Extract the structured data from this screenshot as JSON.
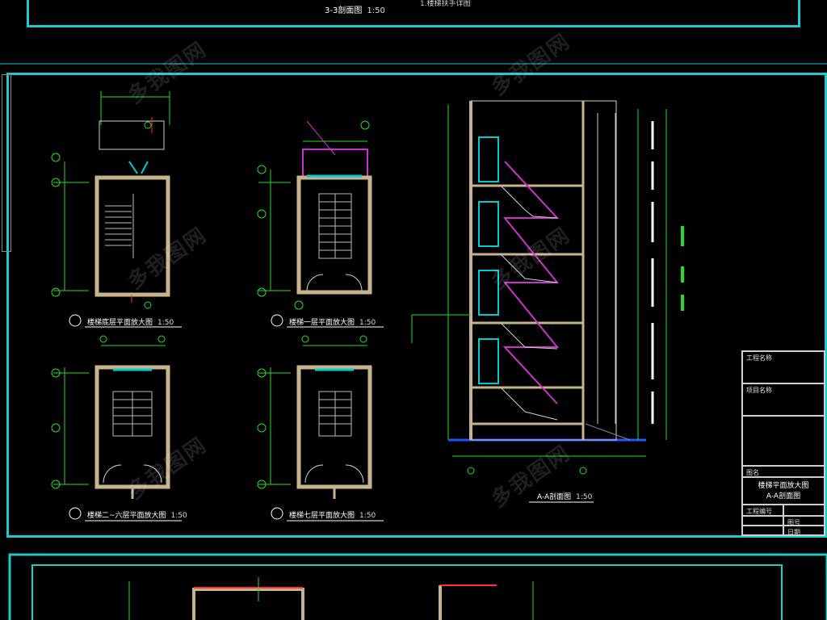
{
  "top_sheet": {
    "section_title": "3-3剖面图",
    "section_scale": "1:50",
    "note": "1.楼梯扶手详图"
  },
  "main_sheet": {
    "plans": [
      {
        "title": "楼梯底层平面放大图",
        "scale": "1:50"
      },
      {
        "title": "楼梯一层平面放大图",
        "scale": "1:50"
      },
      {
        "title": "楼梯二~六层平面放大图",
        "scale": "1:50"
      },
      {
        "title": "楼梯七层平面放大图",
        "scale": "1:50"
      }
    ],
    "section": {
      "title": "A-A剖面图",
      "scale": "1:50"
    },
    "title_block": {
      "project_label": "工程名称",
      "subproject_label": "项目名称",
      "drawing_label": "图名",
      "drawing_title_line1": "楼梯平面放大图",
      "drawing_title_line2": "A-A剖面图",
      "row_label_1": "工程编号",
      "row_label_2": "图号",
      "row_label_3": "日期"
    }
  },
  "watermark": {
    "text": "多我图网"
  },
  "colors": {
    "frame": "#1ec9c9",
    "dimension": "#22dd22",
    "wall": "#c8b48c",
    "stair_section": "#cc33cc",
    "opening": "#00cccc",
    "axis_cut": "#ff3333",
    "paper": "#000000"
  }
}
